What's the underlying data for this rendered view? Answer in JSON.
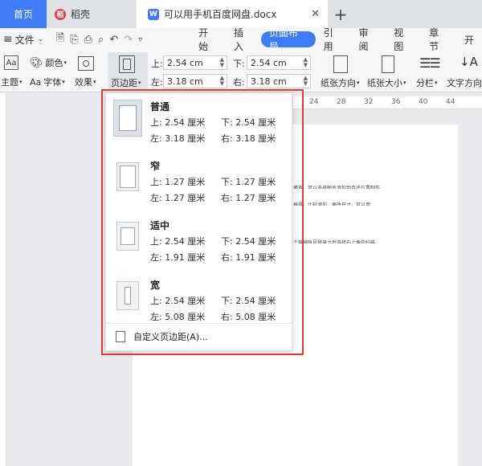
{
  "tabs": {
    "home": "首页",
    "daoke": "稻壳",
    "doc": "可以用手机百度网盘.docx",
    "close": "✕",
    "new": "+"
  },
  "menu": {
    "file": "文件",
    "items": [
      "开始",
      "插入",
      "页面布局",
      "引用",
      "审阅",
      "视图",
      "章节",
      "开"
    ],
    "active": "页面布局"
  },
  "ribbon": {
    "theme": "主题",
    "color": "颜色",
    "font": "字体",
    "effect": "效果",
    "margins": "页边距",
    "top_label": "上:",
    "top_value": "2.54 cm",
    "bottom_label": "下:",
    "bottom_value": "2.54 cm",
    "left_label": "左:",
    "left_value": "3.18 cm",
    "right_label": "右:",
    "right_value": "3.18 cm",
    "orientation": "纸张方向",
    "size": "纸张大小",
    "columns": "分栏",
    "direction": "文字方向"
  },
  "ruler": [
    "24",
    "28",
    "32",
    "36",
    "40",
    "44"
  ],
  "doc_lines": [
    "播放，可以选择图片添加到合适位置制作",
    "搞得，比较添加，更改尺寸，可以用",
    "个营销账号登录之后选择右上角的扫描。"
  ],
  "margin_options": [
    {
      "name": "普通",
      "top": "上: 2.54 厘米",
      "bottom": "下: 2.54 厘米",
      "left": "左: 3.18 厘米",
      "right": "右: 3.18 厘米"
    },
    {
      "name": "窄",
      "top": "上: 1.27 厘米",
      "bottom": "下: 1.27 厘米",
      "left": "左: 1.27 厘米",
      "right": "右: 1.27 厘米"
    },
    {
      "name": "适中",
      "top": "上: 2.54 厘米",
      "bottom": "下: 2.54 厘米",
      "left": "左: 1.91 厘米",
      "right": "右: 1.91 厘米"
    },
    {
      "name": "宽",
      "top": "上: 2.54 厘米",
      "bottom": "下: 2.54 厘米",
      "left": "左: 5.08 厘米",
      "right": "右: 5.08 厘米"
    }
  ],
  "custom_margins": "自定义页边距(A)...",
  "colors": {
    "accent": "#3e7bf5",
    "highlight": "#e53935",
    "daoke": "#e43b3b"
  }
}
